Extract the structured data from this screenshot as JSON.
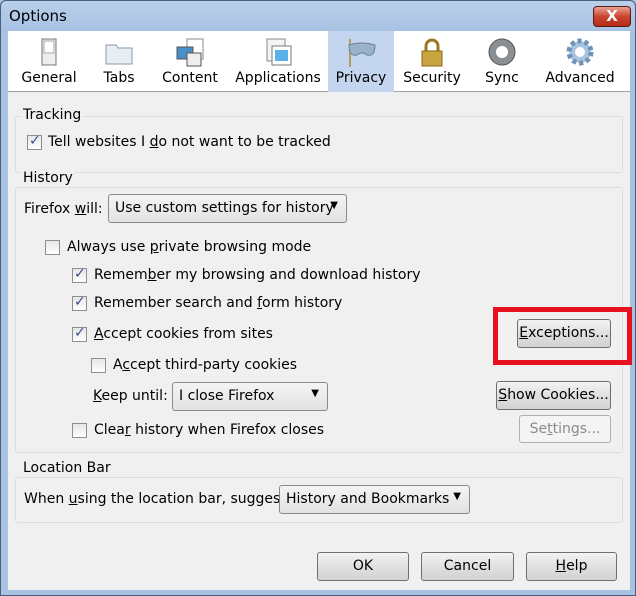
{
  "window": {
    "title": "Options",
    "close_label": "X"
  },
  "tabs": [
    {
      "label": "General",
      "icon": "switch-icon"
    },
    {
      "label": "Tabs",
      "icon": "folder-icon"
    },
    {
      "label": "Content",
      "icon": "content-icon"
    },
    {
      "label": "Applications",
      "icon": "applications-icon"
    },
    {
      "label": "Privacy",
      "icon": "mask-icon",
      "selected": true
    },
    {
      "label": "Security",
      "icon": "lock-icon"
    },
    {
      "label": "Sync",
      "icon": "sync-icon"
    },
    {
      "label": "Advanced",
      "icon": "gear-icon"
    }
  ],
  "tracking": {
    "legend": "Tracking",
    "dnt": {
      "label": "Tell websites I do not want to be tracked",
      "key": "d",
      "checked": true
    }
  },
  "history": {
    "legend": "History",
    "firefox_will_label": "Firefox will:",
    "firefox_will_key": "w",
    "firefox_will_value": "Use custom settings for history",
    "private": {
      "label": "Always use private browsing mode",
      "key": "p",
      "checked": false
    },
    "remember_browsing": {
      "label": "Remember my browsing and download history",
      "key": "b",
      "checked": true
    },
    "remember_search": {
      "label": "Remember search and form history",
      "key": "f",
      "checked": true
    },
    "accept_cookies": {
      "label": "Accept cookies from sites",
      "key": "A",
      "checked": true
    },
    "third_party": {
      "label": "Accept third-party cookies",
      "key": "c",
      "checked": false
    },
    "keep_until_label": "Keep until:",
    "keep_until_key": "K",
    "keep_until_value": "I close Firefox",
    "clear_history": {
      "label": "Clear history when Firefox closes",
      "key": "r",
      "checked": false
    },
    "exceptions": "Exceptions...",
    "exceptions_key": "E",
    "show_cookies": "Show Cookies...",
    "show_cookies_key": "S",
    "settings": "Settings...",
    "settings_key": "t"
  },
  "location": {
    "legend": "Location Bar",
    "suggest_label": "When using the location bar, suggest:",
    "suggest_key": "u",
    "suggest_value": "History and Bookmarks"
  },
  "footer": {
    "ok": "OK",
    "cancel": "Cancel",
    "help": "Help",
    "help_key": "H"
  },
  "colors": {
    "highlight": "#e8101e",
    "selected_tab": "#c4d6ef"
  }
}
